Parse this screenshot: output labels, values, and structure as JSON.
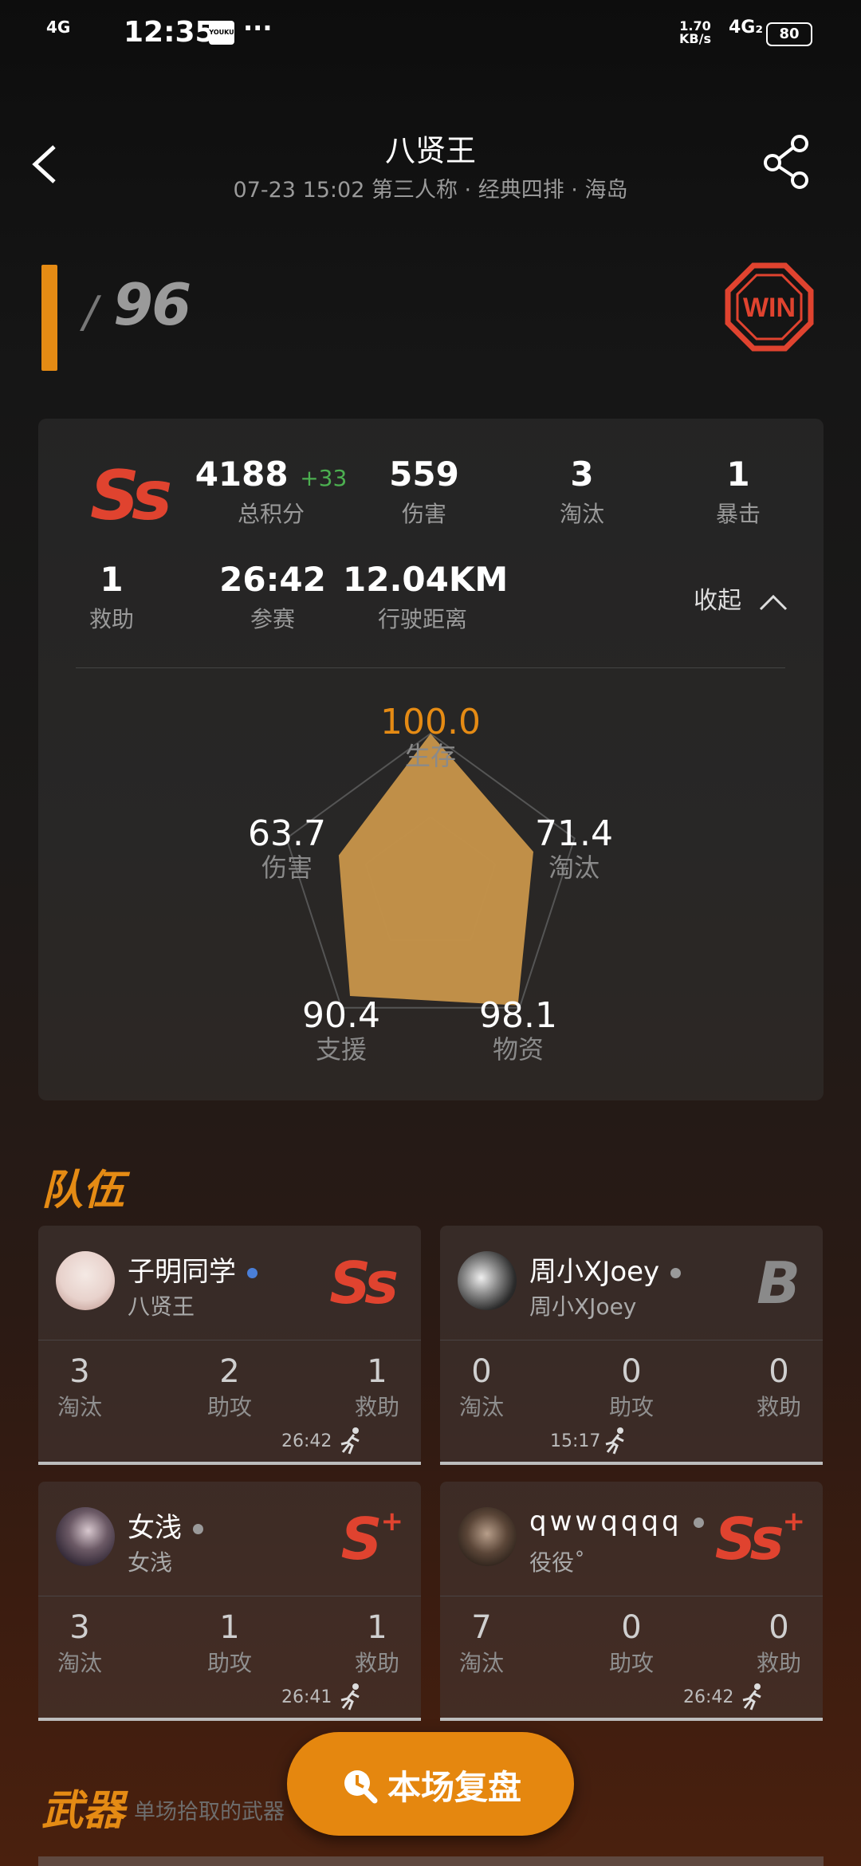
{
  "status_bar": {
    "signal": "4G",
    "time": "12:35",
    "app_badge": "YOUKU",
    "more": "···",
    "speed_value": "1.70",
    "speed_unit": "KB/s",
    "network": "4G₂",
    "battery": "80"
  },
  "header": {
    "title": "八贤王",
    "subtitle": "07-23 15:02 第三人称 · 经典四排 · 海岛"
  },
  "rank": {
    "slash": "/",
    "total": "96",
    "badge": "WIN"
  },
  "summary": {
    "grade": "Ss",
    "score": {
      "value": "4188",
      "delta": "+33",
      "label": "总积分"
    },
    "damage": {
      "value": "559",
      "label": "伤害"
    },
    "kills": {
      "value": "3",
      "label": "淘汰"
    },
    "crits": {
      "value": "1",
      "label": "暴击"
    },
    "assists": {
      "value": "1",
      "label": "救助"
    },
    "duration": {
      "value": "26:42",
      "label": "参赛"
    },
    "distance": {
      "value": "12.04KM",
      "label": "行驶距离"
    },
    "collapse_label": "收起"
  },
  "radar": {
    "survival": {
      "value": "100.0",
      "label": "生存"
    },
    "elimination": {
      "value": "71.4",
      "label": "淘汰"
    },
    "supplies": {
      "value": "98.1",
      "label": "物资"
    },
    "support": {
      "value": "90.4",
      "label": "支援"
    },
    "damage": {
      "value": "63.7",
      "label": "伤害"
    }
  },
  "team": {
    "title": "队伍",
    "labels": {
      "kills": "淘汰",
      "assists": "助攻",
      "rescues": "救助"
    },
    "members": [
      {
        "name": "子明同学",
        "id": "八贤王",
        "grade": "Ss",
        "grade_plus": "",
        "dot_color": "#4a7fd8",
        "kills": "3",
        "assists": "2",
        "rescues": "1",
        "time": "26:42"
      },
      {
        "name": "周小XJoey",
        "id": "周小XJoey",
        "grade": "B",
        "grade_plus": "",
        "dot_color": "#9a9a9a",
        "kills": "0",
        "assists": "0",
        "rescues": "0",
        "time": "15:17"
      },
      {
        "name": "女浅",
        "id": "女浅",
        "grade": "S",
        "grade_plus": "+",
        "dot_color": "#9a9a9a",
        "kills": "3",
        "assists": "1",
        "rescues": "1",
        "time": "26:41"
      },
      {
        "name": "qwwqqqq",
        "id": "役役˚",
        "grade": "Ss",
        "grade_plus": "+",
        "dot_color": "#9a9a9a",
        "kills": "7",
        "assists": "0",
        "rescues": "0",
        "time": "26:42"
      }
    ]
  },
  "weapons": {
    "title": "武器",
    "subtitle": "单场拾取的武器"
  },
  "replay_button": {
    "label": "本场复盘"
  },
  "colors": {
    "accent": "#e58b14",
    "grade_red": "#e0432f",
    "delta_green": "#4caf50"
  }
}
